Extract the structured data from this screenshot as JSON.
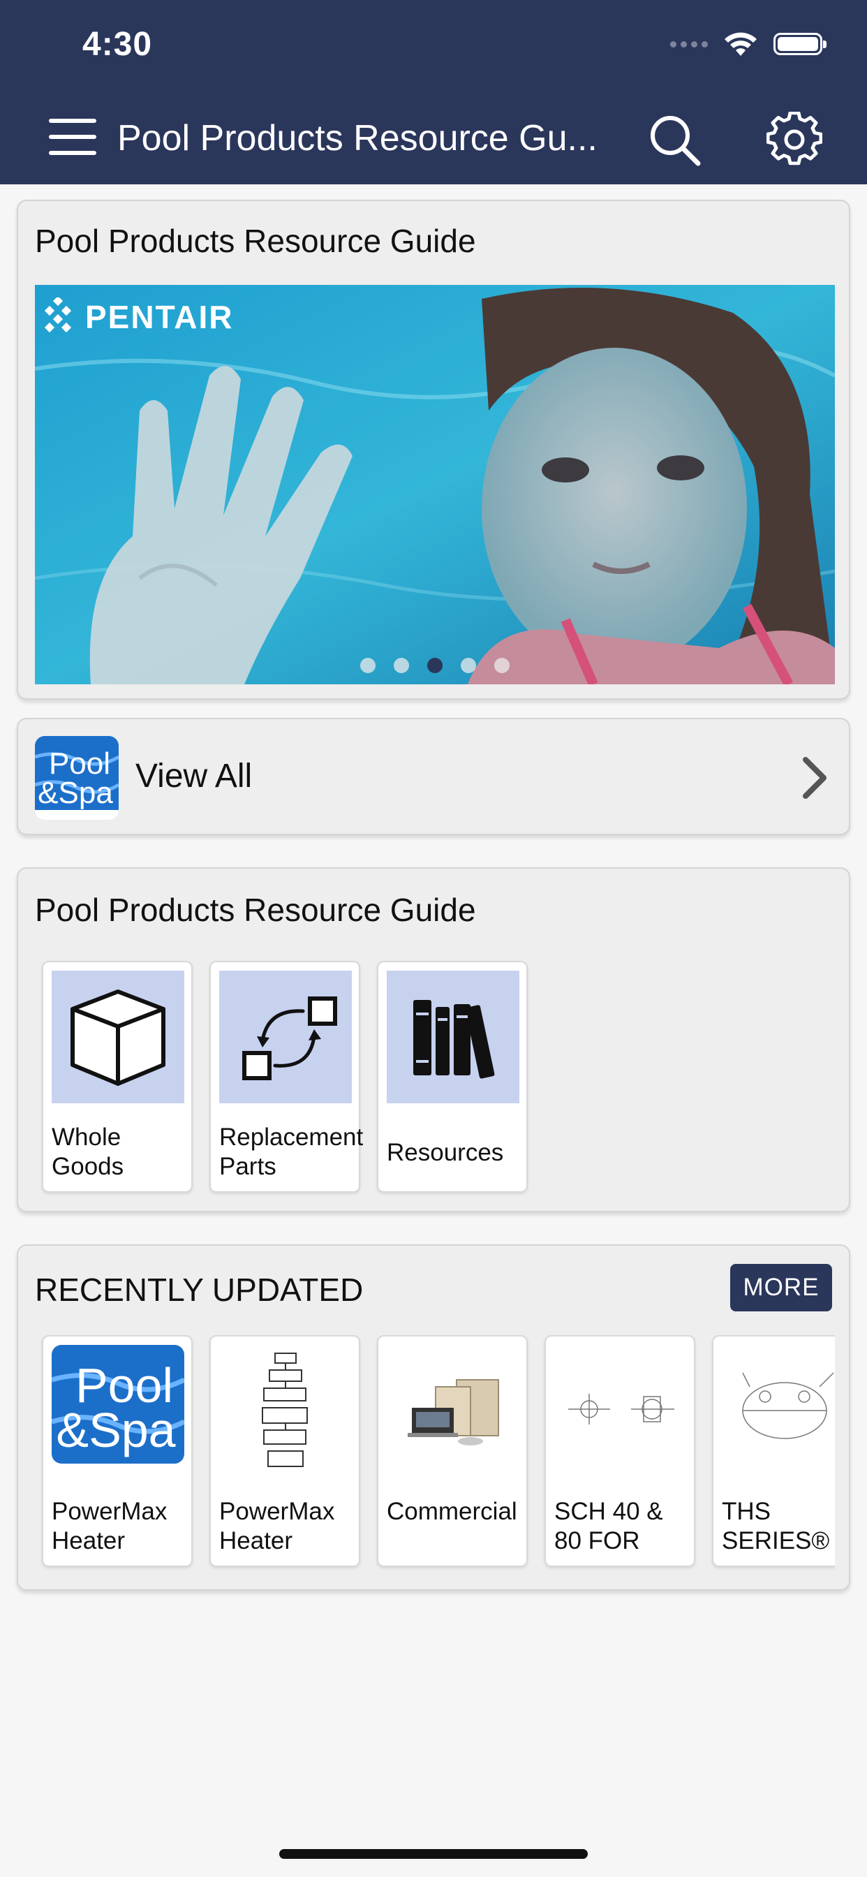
{
  "status_bar": {
    "time": "4:30"
  },
  "nav": {
    "title": "Pool Products Resource Gu..."
  },
  "hero_card": {
    "title": "Pool Products Resource Guide",
    "brand_logo_text": "PENTAIR",
    "carousel": {
      "total": 5,
      "active_index": 2
    }
  },
  "view_all": {
    "label": "View All",
    "icon_text": [
      "Pool",
      "&Spa"
    ]
  },
  "categories": {
    "title": "Pool Products Resource Guide",
    "items": [
      {
        "label": "Whole Goods",
        "icon": "box-icon"
      },
      {
        "label": "Replacement Parts",
        "icon": "swap-arrows-icon"
      },
      {
        "label": "Resources",
        "icon": "books-icon"
      }
    ]
  },
  "recent": {
    "title": "RECENTLY UPDATED",
    "more_label": "MORE",
    "items": [
      {
        "label": "PowerMax Heater",
        "thumb": "pool-spa-logo"
      },
      {
        "label": "PowerMax Heater",
        "thumb": "exploded-diagram"
      },
      {
        "label": "Commercial",
        "thumb": "commercial-equipment"
      },
      {
        "label": "SCH 40 & 80 FOR",
        "thumb": "pipe-diagram"
      },
      {
        "label": "THS SERIES®",
        "thumb": "filter-diagram"
      }
    ]
  },
  "colors": {
    "nav_bar": "#2b365b",
    "tile_bg": "#c7d2ef",
    "card_bg": "#eeeeee"
  }
}
